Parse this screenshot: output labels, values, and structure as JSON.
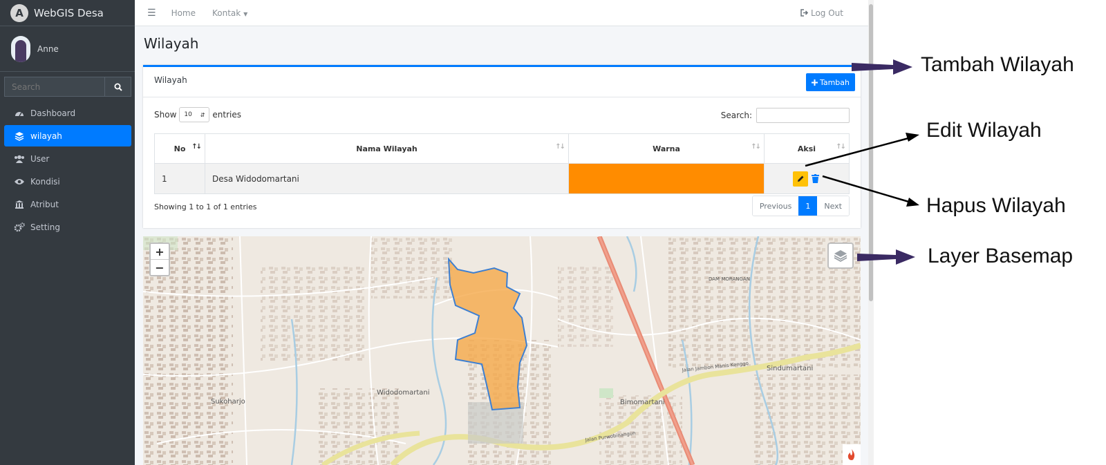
{
  "app": {
    "brand": "WebGIS Desa",
    "user": "Anne"
  },
  "sidebar": {
    "search_placeholder": "Search",
    "items": [
      {
        "label": "Dashboard",
        "icon": "dashboard-icon"
      },
      {
        "label": "wilayah",
        "icon": "layers-icon",
        "active": true
      },
      {
        "label": "User",
        "icon": "users-icon"
      },
      {
        "label": "Kondisi",
        "icon": "eye-icon"
      },
      {
        "label": "Atribut",
        "icon": "building-icon"
      },
      {
        "label": "Setting",
        "icon": "cogs-icon"
      }
    ]
  },
  "topbar": {
    "home": "Home",
    "kontak": "Kontak",
    "logout": "Log Out"
  },
  "page": {
    "title": "Wilayah"
  },
  "card": {
    "title": "Wilayah",
    "tambah_label": "Tambah",
    "show_label": "Show",
    "entries_value": "10",
    "entries_label": "entries",
    "search_label": "Search:",
    "columns": [
      "No",
      "Nama Wilayah",
      "Warna",
      "Aksi"
    ],
    "rows": [
      {
        "no": "1",
        "nama": "Desa Widodomartani",
        "warna": "#ff8c00"
      }
    ],
    "info": "Showing 1 to 1 of 1 entries",
    "pager": {
      "prev": "Previous",
      "page": "1",
      "next": "Next"
    }
  },
  "map": {
    "labels": {
      "widodomartani": "Widodomartani",
      "bimomartani": "Bimomartani",
      "sukoharjo": "Sukoharjo",
      "sindumartani": "Sindumartani",
      "dam": "DAM MORANGAN",
      "jalan1": "Jalan Jambon Manis Kenggo",
      "jalan2": "Jalan Purwobinangun"
    },
    "polygon_color": "#f5a94a"
  },
  "annotations": {
    "tambah": "Tambah Wilayah",
    "edit": "Edit Wilayah",
    "hapus": "Hapus Wilayah",
    "basemap": "Layer Basemap"
  }
}
